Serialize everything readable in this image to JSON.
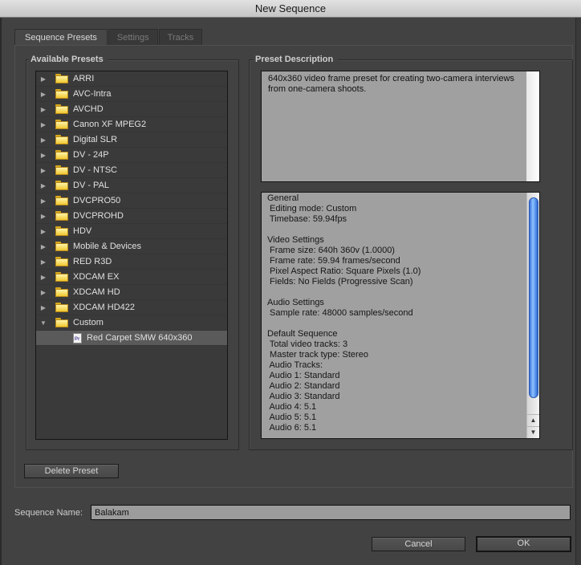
{
  "window": {
    "title": "New Sequence"
  },
  "tabs": [
    {
      "label": "Sequence Presets",
      "active": true
    },
    {
      "label": "Settings",
      "active": false
    },
    {
      "label": "Tracks",
      "active": false
    }
  ],
  "available_presets": {
    "title": "Available Presets",
    "items": [
      {
        "label": "ARRI",
        "type": "folder",
        "expanded": false
      },
      {
        "label": "AVC-Intra",
        "type": "folder",
        "expanded": false
      },
      {
        "label": "AVCHD",
        "type": "folder",
        "expanded": false
      },
      {
        "label": "Canon XF MPEG2",
        "type": "folder",
        "expanded": false
      },
      {
        "label": "Digital SLR",
        "type": "folder",
        "expanded": false
      },
      {
        "label": "DV - 24P",
        "type": "folder",
        "expanded": false
      },
      {
        "label": "DV - NTSC",
        "type": "folder",
        "expanded": false
      },
      {
        "label": "DV - PAL",
        "type": "folder",
        "expanded": false
      },
      {
        "label": "DVCPRO50",
        "type": "folder",
        "expanded": false
      },
      {
        "label": "DVCPROHD",
        "type": "folder",
        "expanded": false
      },
      {
        "label": "HDV",
        "type": "folder",
        "expanded": false
      },
      {
        "label": "Mobile & Devices",
        "type": "folder",
        "expanded": false
      },
      {
        "label": "RED R3D",
        "type": "folder",
        "expanded": false
      },
      {
        "label": "XDCAM EX",
        "type": "folder",
        "expanded": false
      },
      {
        "label": "XDCAM HD",
        "type": "folder",
        "expanded": false
      },
      {
        "label": "XDCAM HD422",
        "type": "folder",
        "expanded": false
      },
      {
        "label": "Custom",
        "type": "folder",
        "expanded": true
      },
      {
        "label": "Red Carpet SMW 640x360",
        "type": "preset",
        "selected": true,
        "icon_text": "Pr"
      }
    ]
  },
  "preset_description": {
    "title": "Preset Description",
    "text": "640x360 video frame preset for creating two-camera interviews from one-camera shoots.",
    "details": [
      "General",
      " Editing mode: Custom",
      " Timebase: 59.94fps",
      "",
      "Video Settings",
      " Frame size: 640h 360v (1.0000)",
      " Frame rate: 59.94 frames/second",
      " Pixel Aspect Ratio: Square Pixels (1.0)",
      " Fields: No Fields (Progressive Scan)",
      "",
      "Audio Settings",
      " Sample rate: 48000 samples/second",
      "",
      "Default Sequence",
      " Total video tracks: 3",
      " Master track type: Stereo",
      " Audio Tracks:",
      " Audio 1: Standard",
      " Audio 2: Standard",
      " Audio 3: Standard",
      " Audio 4: 5.1",
      " Audio 5: 5.1",
      " Audio 6: 5.1"
    ],
    "scroll_up_glyph": "▲",
    "scroll_down_glyph": "▼"
  },
  "buttons": {
    "delete_preset": "Delete Preset",
    "cancel": "Cancel",
    "ok": "OK"
  },
  "sequence_name": {
    "label": "Sequence Name:",
    "value": "Balakam"
  },
  "glyphs": {
    "collapsed": "▶",
    "expanded": "▼"
  }
}
